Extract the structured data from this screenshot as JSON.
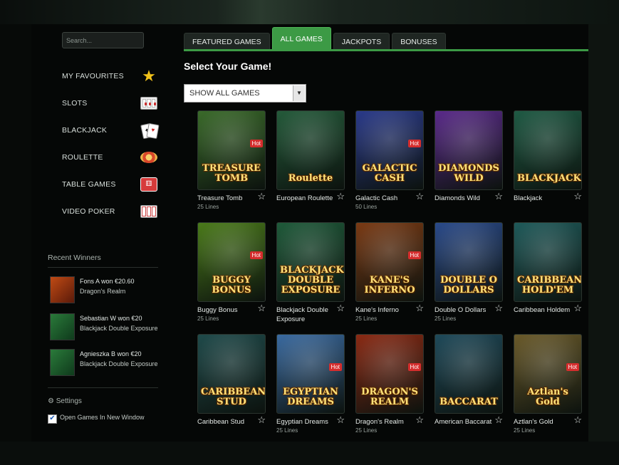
{
  "search": {
    "placeholder": "Search..."
  },
  "sidebar": {
    "items": [
      {
        "label": "MY FAVOURITES",
        "icon": "star-icon"
      },
      {
        "label": "SLOTS",
        "icon": "slot-machine-icon"
      },
      {
        "label": "BLACKJACK",
        "icon": "cards-icon"
      },
      {
        "label": "ROULETTE",
        "icon": "roulette-icon"
      },
      {
        "label": "TABLE GAMES",
        "icon": "dice-icon"
      },
      {
        "label": "VIDEO POKER",
        "icon": "video-poker-icon"
      }
    ]
  },
  "recent_winners": {
    "title": "Recent Winners",
    "items": [
      {
        "line1": "Fons A won €20.60",
        "line2": "Dragon's Realm"
      },
      {
        "line1": "Sebastian W won €20",
        "line2": "Blackjack Double Exposure"
      },
      {
        "line1": "Agnieszka B won €20",
        "line2": "Blackjack Double Exposure"
      }
    ]
  },
  "settings": {
    "title": "Settings",
    "option_label": "Open Games In New Window",
    "option_checked": true
  },
  "tabs": [
    {
      "label": "FEATURED GAMES",
      "active": false
    },
    {
      "label": "ALL GAMES",
      "active": true
    },
    {
      "label": "JACKPOTS",
      "active": false
    },
    {
      "label": "BONUSES",
      "active": false
    }
  ],
  "main": {
    "title": "Select Your Game!",
    "filter": {
      "selected": "SHOW ALL GAMES"
    }
  },
  "hot_label": "Hot",
  "games": [
    {
      "name": "Treasure Tomb",
      "lines": "25 Lines",
      "logo": "TREASURE TOMB",
      "hot": true,
      "bg": "#3a6a2a"
    },
    {
      "name": "European Roulette",
      "lines": "",
      "logo": "Roulette",
      "hot": false,
      "bg": "#245a3a"
    },
    {
      "name": "Galactic Cash",
      "lines": "50 Lines",
      "logo": "GALACTIC CASH",
      "hot": true,
      "bg": "#2a3a8a"
    },
    {
      "name": "Diamonds Wild",
      "lines": "",
      "logo": "DIAMONDS WILD",
      "hot": false,
      "bg": "#5a2a8a"
    },
    {
      "name": "Blackjack",
      "lines": "",
      "logo": "BLACKJACK",
      "hot": false,
      "bg": "#1f5a44"
    },
    {
      "name": "Buggy Bonus",
      "lines": "25 Lines",
      "logo": "BUGGY BONUS",
      "hot": true,
      "bg": "#4a7a1a"
    },
    {
      "name": "Blackjack Double Exposure",
      "lines": "",
      "logo": "BLACKJACK DOUBLE EXPOSURE",
      "hot": false,
      "bg": "#1f5a3a"
    },
    {
      "name": "Kane's Inferno",
      "lines": "25 Lines",
      "logo": "KANE'S INFERNO",
      "hot": true,
      "bg": "#7a3a14"
    },
    {
      "name": "Double O Dollars",
      "lines": "25 Lines",
      "logo": "DOUBLE O DOLLARS",
      "hot": false,
      "bg": "#2a4a8a"
    },
    {
      "name": "Caribbean Holdem",
      "lines": "",
      "logo": "CARIBBEAN HOLD'EM",
      "hot": false,
      "bg": "#1f5a5a"
    },
    {
      "name": "Caribbean Stud",
      "lines": "",
      "logo": "CARIBBEAN STUD",
      "hot": false,
      "bg": "#1f4a4a"
    },
    {
      "name": "Egyptian Dreams",
      "lines": "25 Lines",
      "logo": "EGYPTIAN DREAMS",
      "hot": true,
      "bg": "#3a6aa0"
    },
    {
      "name": "Dragon's Realm",
      "lines": "25 Lines",
      "logo": "DRAGON'S REALM",
      "hot": true,
      "bg": "#8a2a14"
    },
    {
      "name": "American Baccarat",
      "lines": "",
      "logo": "BACCARAT",
      "hot": false,
      "bg": "#1f4a5a"
    },
    {
      "name": "Aztlan's Gold",
      "lines": "25 Lines",
      "logo": "Aztlan's Gold",
      "hot": true,
      "bg": "#6a5a2a"
    }
  ]
}
